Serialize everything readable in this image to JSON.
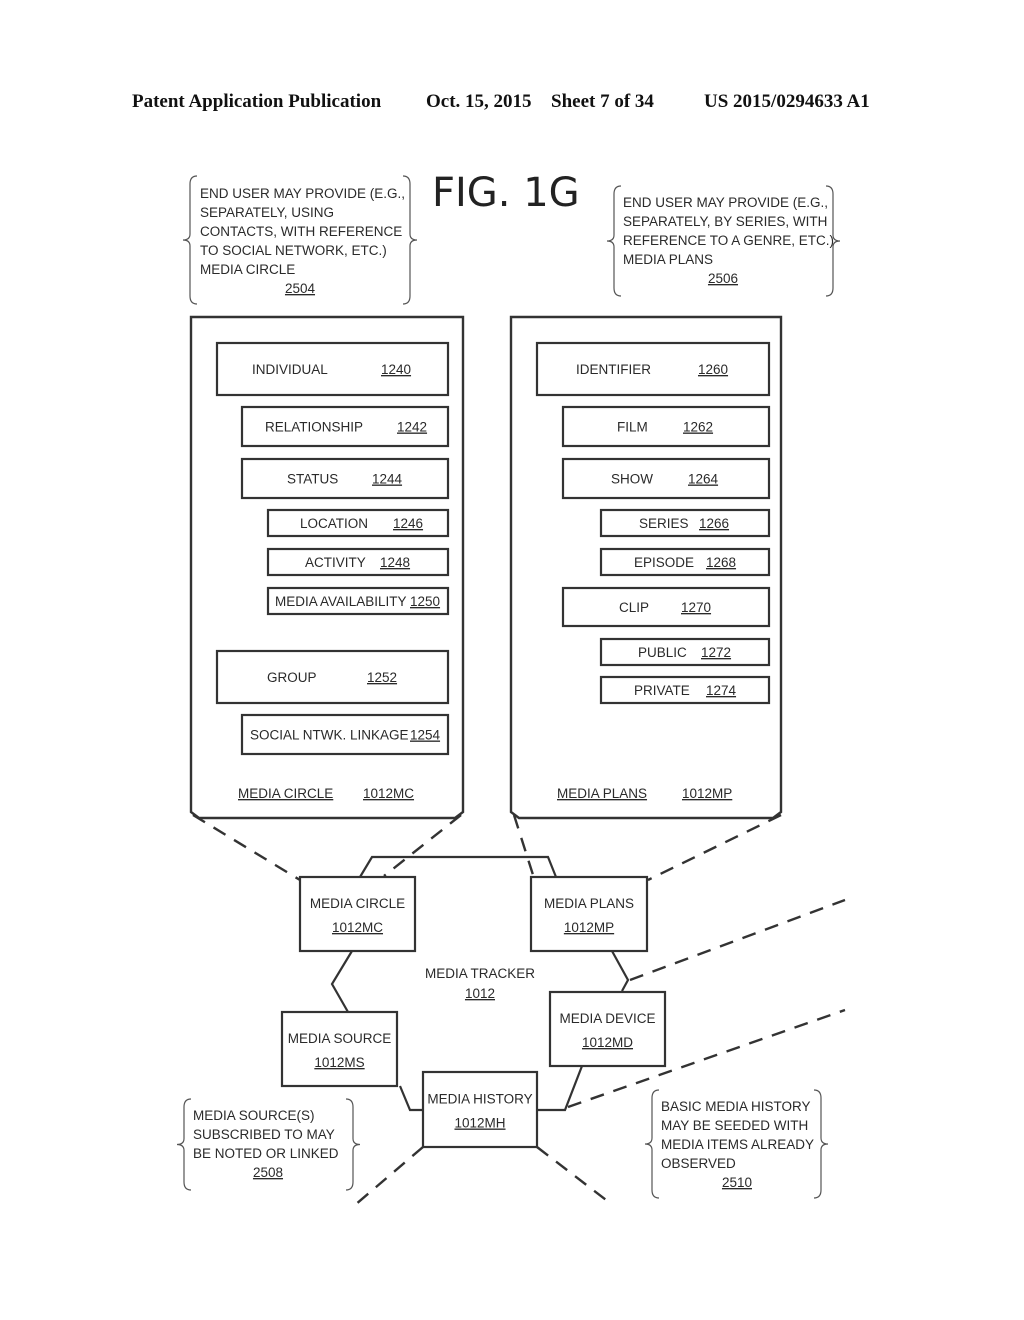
{
  "header": {
    "publication": "Patent Application Publication",
    "date": "Oct. 15, 2015",
    "sheet": "Sheet 7 of 34",
    "patent_number": "US 2015/0294633 A1"
  },
  "figure_title": "FIG. 1G",
  "notes": {
    "media_circle_note": {
      "lines": [
        "END USER MAY PROVIDE (E.G.,",
        "SEPARATELY, USING",
        "CONTACTS, WITH REFERENCE",
        "TO SOCIAL NETWORK, ETC.)",
        "MEDIA CIRCLE"
      ],
      "ref": "2504"
    },
    "media_plans_note": {
      "lines": [
        "END USER MAY PROVIDE (E.G.,",
        "SEPARATELY, BY SERIES, WITH",
        "REFERENCE TO A GENRE, ETC.)",
        "MEDIA PLANS"
      ],
      "ref": "2506"
    },
    "media_source_note": {
      "lines": [
        "MEDIA SOURCE(S)",
        "SUBSCRIBED TO MAY",
        "BE NOTED OR LINKED"
      ],
      "ref": "2508"
    },
    "media_history_note": {
      "lines": [
        "BASIC MEDIA HISTORY",
        "MAY BE SEEDED WITH",
        "MEDIA ITEMS ALREADY",
        "OBSERVED"
      ],
      "ref": "2510"
    }
  },
  "media_circle_panel": {
    "footer_label": "MEDIA CIRCLE",
    "footer_ref": "1012MC",
    "items": [
      {
        "label": "INDIVIDUAL",
        "ref": "1240"
      },
      {
        "label": "RELATIONSHIP",
        "ref": "1242"
      },
      {
        "label": "STATUS",
        "ref": "1244"
      },
      {
        "label": "LOCATION",
        "ref": "1246"
      },
      {
        "label": "ACTIVITY",
        "ref": "1248"
      },
      {
        "label": "MEDIA AVAILABILITY",
        "ref": "1250"
      },
      {
        "label": "GROUP",
        "ref": "1252"
      },
      {
        "label": "SOCIAL NTWK. LINKAGE",
        "ref": "1254"
      }
    ]
  },
  "media_plans_panel": {
    "footer_label": "MEDIA PLANS",
    "footer_ref": "1012MP",
    "items": [
      {
        "label": "IDENTIFIER",
        "ref": "1260"
      },
      {
        "label": "FILM",
        "ref": "1262"
      },
      {
        "label": "SHOW",
        "ref": "1264"
      },
      {
        "label": "SERIES",
        "ref": "1266"
      },
      {
        "label": "EPISODE",
        "ref": "1268"
      },
      {
        "label": "CLIP",
        "ref": "1270"
      },
      {
        "label": "PUBLIC",
        "ref": "1272"
      },
      {
        "label": "PRIVATE",
        "ref": "1274"
      }
    ]
  },
  "tracker": {
    "label": "MEDIA TRACKER",
    "ref": "1012",
    "nodes": {
      "media_circle": {
        "label": "MEDIA CIRCLE",
        "ref": "1012MC"
      },
      "media_plans": {
        "label": "MEDIA PLANS",
        "ref": "1012MP"
      },
      "media_source": {
        "label": "MEDIA SOURCE",
        "ref": "1012MS"
      },
      "media_device": {
        "label": "MEDIA DEVICE",
        "ref": "1012MD"
      },
      "media_history": {
        "label": "MEDIA HISTORY",
        "ref": "1012MH"
      }
    }
  }
}
